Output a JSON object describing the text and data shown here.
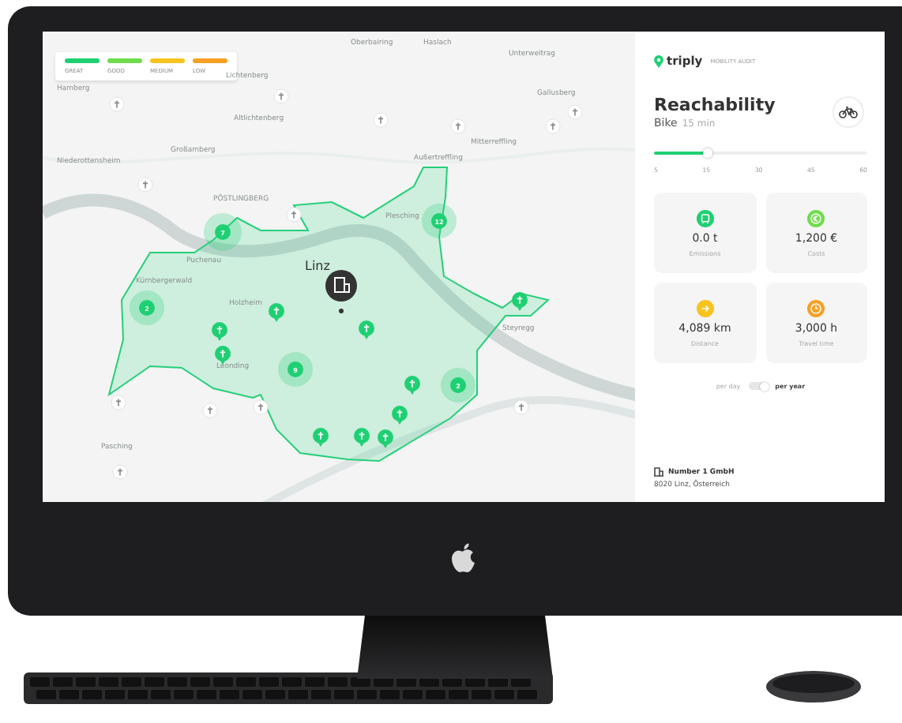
{
  "map": {
    "legend": [
      {
        "label": "GREAT",
        "color": "#1fd073"
      },
      {
        "label": "GOOD",
        "color": "#6fdc4c"
      },
      {
        "label": "MEDIUM",
        "color": "#f7c31f"
      },
      {
        "label": "LOW",
        "color": "#f7a024"
      }
    ],
    "places": [
      "Lichtenberg",
      "Altlichtenberg",
      "Großamberg",
      "Hamberg",
      "Niederottensheim",
      "PÖSTLINGBERG",
      "Puchenau",
      "Kürnbergerwald",
      "Holzheim",
      "Leonding",
      "Pasching",
      "Mitterreffling",
      "Außertreffling",
      "Plesching",
      "Steyregg",
      "Gallusberg",
      "Oberbairing",
      "Haslach",
      "Unterweitrag",
      "Linz"
    ],
    "clusters": [
      {
        "count": "7"
      },
      {
        "count": "12"
      },
      {
        "count": "2"
      },
      {
        "count": "9"
      },
      {
        "count": "2"
      }
    ]
  },
  "panel": {
    "brand": "triply",
    "subtitle": "MOBILITY AUDIT",
    "title": "Reachability",
    "mode": "Bike",
    "duration": "15 min",
    "slider": {
      "level": 0.25,
      "ticks": [
        "5",
        "15",
        "30",
        "45",
        "60"
      ]
    },
    "stats": [
      {
        "kind": "emissions",
        "value": "0.0 t",
        "label": "Emissions",
        "color": "#1fd073"
      },
      {
        "kind": "costs",
        "value": "1,200 €",
        "label": "Costs",
        "color": "#6fdc4c"
      },
      {
        "kind": "distance",
        "value": "4,089 km",
        "label": "Distance",
        "color": "#f7c31f"
      },
      {
        "kind": "time",
        "value": "3,000 h",
        "label": "Travel time",
        "color": "#f7a024"
      }
    ],
    "period_toggle": {
      "off_label": "per day",
      "on_label": "per year",
      "on": true
    },
    "company": {
      "name": "Number 1 GmbH",
      "address": "8020 Linz, Österreich"
    }
  }
}
